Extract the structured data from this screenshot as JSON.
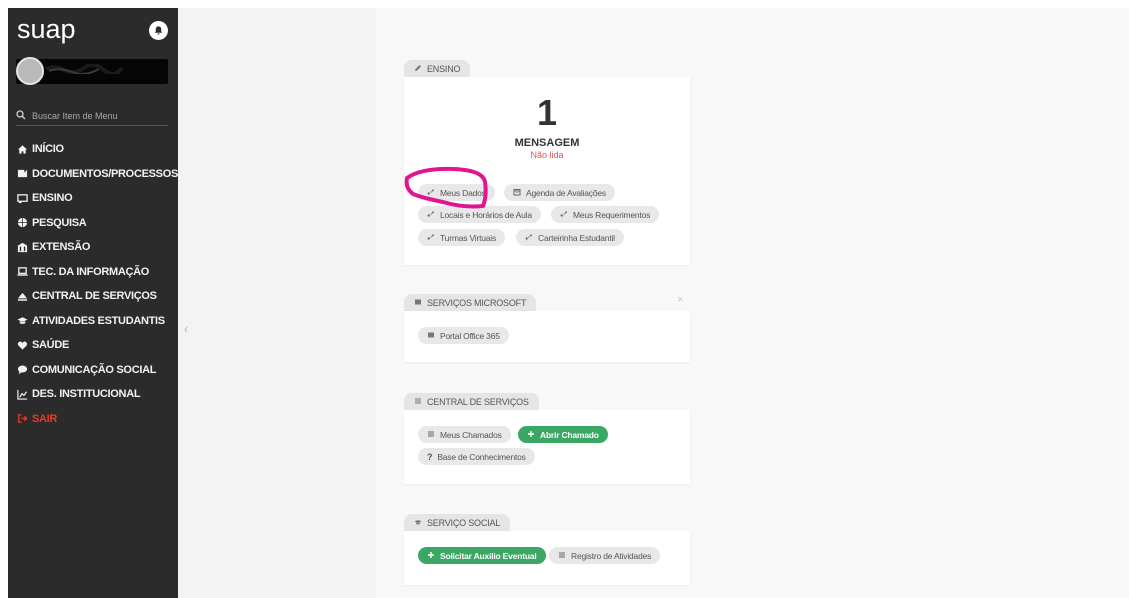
{
  "sidebar": {
    "logo": "suap",
    "search_placeholder": "Buscar Item de Menu",
    "items": [
      {
        "label": "INÍCIO",
        "icon": "home-icon"
      },
      {
        "label": "DOCUMENTOS/PROCESSOS",
        "icon": "document-icon"
      },
      {
        "label": "ENSINO",
        "icon": "chalkboard-icon"
      },
      {
        "label": "PESQUISA",
        "icon": "globe-icon"
      },
      {
        "label": "EXTENSÃO",
        "icon": "building-icon"
      },
      {
        "label": "TEC. DA INFORMAÇÃO",
        "icon": "laptop-icon"
      },
      {
        "label": "CENTRAL DE SERVIÇOS",
        "icon": "eject-icon"
      },
      {
        "label": "ATIVIDADES ESTUDANTIS",
        "icon": "graduation-cap-icon"
      },
      {
        "label": "SAÚDE",
        "icon": "heartbeat-icon"
      },
      {
        "label": "COMUNICAÇÃO SOCIAL",
        "icon": "comment-icon"
      },
      {
        "label": "DES. INSTITUCIONAL",
        "icon": "chart-icon"
      },
      {
        "label": "SAIR",
        "icon": "sign-out-icon"
      }
    ]
  },
  "ensino": {
    "tab": "ENSINO",
    "count": "1",
    "message": "MENSAGEM",
    "unread": "Não lida",
    "links": [
      {
        "label": "Meus Dados",
        "icon": "link-icon"
      },
      {
        "label": "Agenda de Avaliações",
        "icon": "calendar-icon"
      },
      {
        "label": "Locais e Horários de Aula",
        "icon": "link-icon"
      },
      {
        "label": "Meus Requerimentos",
        "icon": "link-icon"
      },
      {
        "label": "Turmas Virtuais",
        "icon": "link-icon"
      },
      {
        "label": "Carteirinha Estudantil",
        "icon": "link-icon"
      }
    ]
  },
  "microsoft": {
    "tab": "SERVIÇOS MICROSOFT",
    "close": "×",
    "links": [
      {
        "label": "Portal Office 365",
        "icon": "windows-icon"
      }
    ]
  },
  "central": {
    "tab": "CENTRAL DE SERVIÇOS",
    "links": [
      {
        "label": "Meus Chamados",
        "icon": "list-icon"
      },
      {
        "label": "Abrir Chamado",
        "icon": "plus-icon"
      },
      {
        "label": "Base de Conhecimentos",
        "icon": "question-icon"
      }
    ]
  },
  "social": {
    "tab": "SERVIÇO SOCIAL",
    "links": [
      {
        "label": "Solicitar Auxílio Eventual",
        "icon": "plus-icon"
      },
      {
        "label": "Registro de Atividades",
        "icon": "list-icon"
      }
    ]
  },
  "colors": {
    "sidebar_bg": "#2b2b2b",
    "accent_green": "#3ca765",
    "danger_red": "#e53b2c",
    "annotation_magenta": "#e0158f"
  }
}
